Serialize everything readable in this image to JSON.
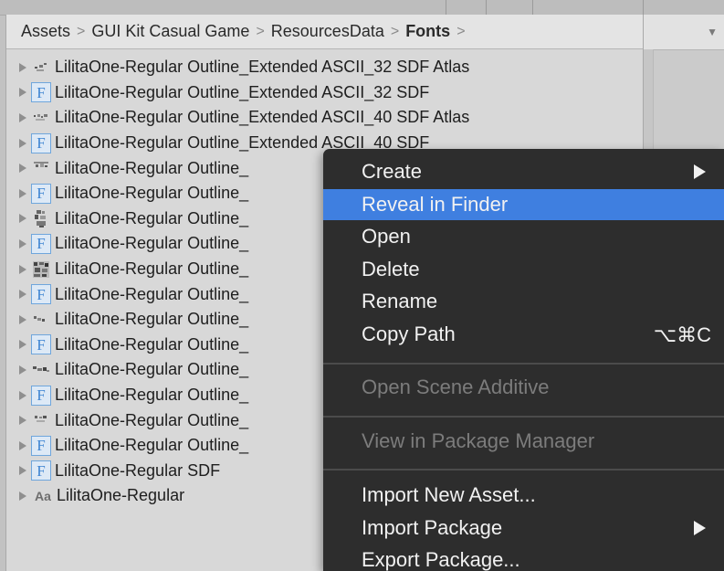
{
  "breadcrumb": {
    "items": [
      "Assets",
      "GUI Kit Casual Game",
      "ResourcesData",
      "Fonts"
    ],
    "separator": ">"
  },
  "files": [
    {
      "icon": "atlas-texture-icon",
      "name": "LilitaOne-Regular Outline_Extended ASCII_32 SDF Atlas"
    },
    {
      "icon": "font-asset-icon",
      "name": "LilitaOne-Regular Outline_Extended ASCII_32 SDF"
    },
    {
      "icon": "atlas-texture-icon",
      "name": "LilitaOne-Regular Outline_Extended ASCII_40 SDF Atlas"
    },
    {
      "icon": "font-asset-icon",
      "name": "LilitaOne-Regular Outline_Extended ASCII_40 SDF"
    },
    {
      "icon": "atlas-texture-icon",
      "name": "LilitaOne-Regular Outline_"
    },
    {
      "icon": "font-asset-icon",
      "name": "LilitaOne-Regular Outline_"
    },
    {
      "icon": "atlas-texture-icon",
      "name": "LilitaOne-Regular Outline_"
    },
    {
      "icon": "font-asset-icon",
      "name": "LilitaOne-Regular Outline_"
    },
    {
      "icon": "atlas-texture-icon",
      "name": "LilitaOne-Regular Outline_"
    },
    {
      "icon": "font-asset-icon",
      "name": "LilitaOne-Regular Outline_"
    },
    {
      "icon": "atlas-texture-icon",
      "name": "LilitaOne-Regular Outline_"
    },
    {
      "icon": "font-asset-icon",
      "name": "LilitaOne-Regular Outline_"
    },
    {
      "icon": "atlas-texture-icon",
      "name": "LilitaOne-Regular Outline_"
    },
    {
      "icon": "font-asset-icon",
      "name": "LilitaOne-Regular Outline_"
    },
    {
      "icon": "atlas-texture-icon",
      "name": "LilitaOne-Regular Outline_"
    },
    {
      "icon": "font-asset-icon",
      "name": "LilitaOne-Regular Outline_"
    },
    {
      "icon": "font-asset-icon",
      "name": "LilitaOne-Regular SDF"
    },
    {
      "icon": "font-file-icon",
      "name": "LilitaOne-Regular"
    }
  ],
  "icon_glyphs": {
    "font_asset": "F",
    "font_file": "Aa"
  },
  "context_menu": {
    "items": [
      {
        "label": "Create",
        "submenu": true
      },
      {
        "label": "Reveal in Finder",
        "highlighted": true
      },
      {
        "label": "Open"
      },
      {
        "label": "Delete"
      },
      {
        "label": "Rename"
      },
      {
        "label": "Copy Path",
        "shortcut": "⌥⌘C"
      },
      {
        "label": "Open Scene Additive",
        "disabled": true
      },
      {
        "label": "View in Package Manager",
        "disabled": true
      },
      {
        "label": "Import New Asset..."
      },
      {
        "label": "Import Package",
        "submenu": true
      },
      {
        "label": "Export Package..."
      }
    ]
  },
  "colors": {
    "menu_bg": "#2d2d2d",
    "menu_highlight": "#3f7fe0",
    "panel_bg": "#d8d8d8",
    "font_icon_blue": "#3f85d2"
  }
}
